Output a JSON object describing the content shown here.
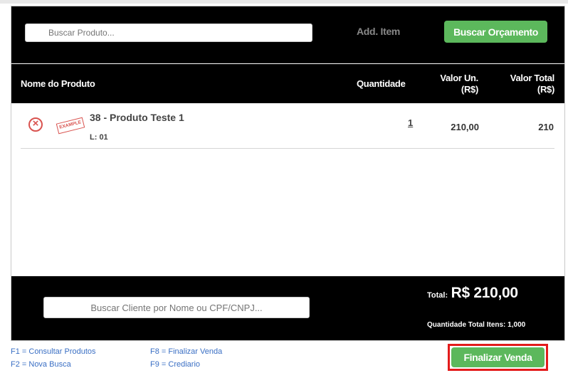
{
  "toolbar": {
    "search_product_placeholder": "Buscar Produto...",
    "add_item_label": "Add. Item",
    "buscar_orcamento_label": "Buscar Orçamento"
  },
  "table": {
    "headers": {
      "name": "Nome do Produto",
      "quantity": "Quantidade",
      "unit_value_1": "Valor Un.",
      "unit_value_2": "(R$)",
      "total_value_1": "Valor Total",
      "total_value_2": "(R$)"
    },
    "rows": [
      {
        "thumb_text": "EXAMPLE",
        "name": "38 - Produto Teste 1",
        "lot": "L: 01",
        "quantity": "1",
        "unit_value": "210,00",
        "total_value": "210"
      }
    ]
  },
  "footer": {
    "search_client_placeholder": "Buscar Cliente por Nome ou CPF/CNPJ...",
    "total_label": "Total:",
    "total_value": "R$ 210,00",
    "qty_total_label": "Quantidade Total Itens:",
    "qty_total_value": "1,000"
  },
  "shortcuts": {
    "f1": "F1 = Consultar Produtos",
    "f2": "F2 = Nova Busca",
    "f8": "F8 = Finalizar Venda",
    "f9": "F9 = Crediario"
  },
  "finalizar_label": "Finalizar Venda",
  "colors": {
    "green": "#5cb85c",
    "highlight_red": "#e31b1b",
    "remove_red": "#d9534f",
    "link_blue": "#3a6fc4"
  },
  "icons": {
    "remove": "remove-circle-icon"
  }
}
